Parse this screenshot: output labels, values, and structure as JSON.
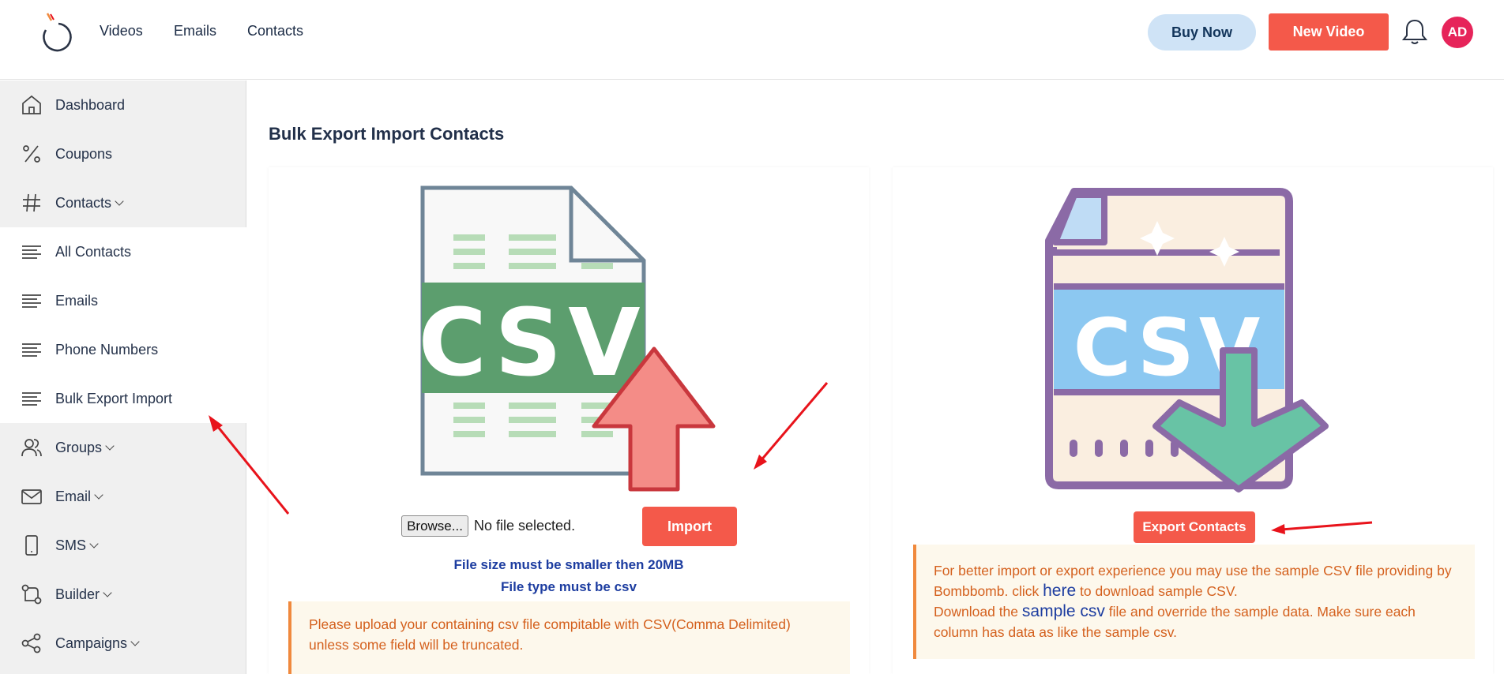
{
  "header": {
    "nav": [
      "Videos",
      "Emails",
      "Contacts"
    ],
    "buy_now": "Buy Now",
    "new_video": "New Video",
    "avatar_initials": "AD"
  },
  "sidebar": {
    "items": [
      {
        "label": "Dashboard",
        "icon": "home-icon",
        "has_chevron": false
      },
      {
        "label": "Coupons",
        "icon": "percent-icon",
        "has_chevron": false
      },
      {
        "label": "Contacts",
        "icon": "hash-icon",
        "has_chevron": true
      },
      {
        "label": "All Contacts",
        "icon": "lines-icon",
        "has_chevron": false
      },
      {
        "label": "Emails",
        "icon": "lines-icon",
        "has_chevron": false
      },
      {
        "label": "Phone Numbers",
        "icon": "lines-icon",
        "has_chevron": false
      },
      {
        "label": "Bulk Export Import",
        "icon": "lines-icon",
        "has_chevron": false
      },
      {
        "label": "Groups",
        "icon": "users-icon",
        "has_chevron": true
      },
      {
        "label": "Email",
        "icon": "mail-icon",
        "has_chevron": true
      },
      {
        "label": "SMS",
        "icon": "phone-icon",
        "has_chevron": true
      },
      {
        "label": "Builder",
        "icon": "builder-icon",
        "has_chevron": true
      },
      {
        "label": "Campaigns",
        "icon": "share-icon",
        "has_chevron": true
      }
    ]
  },
  "main": {
    "title": "Bulk Export Import Contacts",
    "import_panel": {
      "illustration_text": "CSV",
      "browse_label": "Browse...",
      "file_status": "No file selected.",
      "import_label": "Import",
      "hint_size": "File size must be smaller then 20MB",
      "hint_type": "File type must be csv",
      "note": "Please upload your containing csv file compitable with CSV(Comma Delimited) unless some field will be truncated."
    },
    "export_panel": {
      "illustration_text": "CSV",
      "export_label": "Export Contacts",
      "note_part1": "For better import or export experience you may use the sample CSV file providing by Bombbomb. click ",
      "note_link1": "here",
      "note_part2": " to download sample CSV.",
      "note_part3": "Download the ",
      "note_link2": "sample csv",
      "note_part4": " file and override the sample data. Make sure each column has data as like the sample csv."
    }
  },
  "colors": {
    "accent": "#f4594a",
    "buy_bg": "#cfe3f6",
    "avatar": "#e6245a",
    "link": "#1d3da0",
    "note_text": "#d4601d",
    "note_border": "#f0893d",
    "annotation_arrow": "#e8131b"
  }
}
